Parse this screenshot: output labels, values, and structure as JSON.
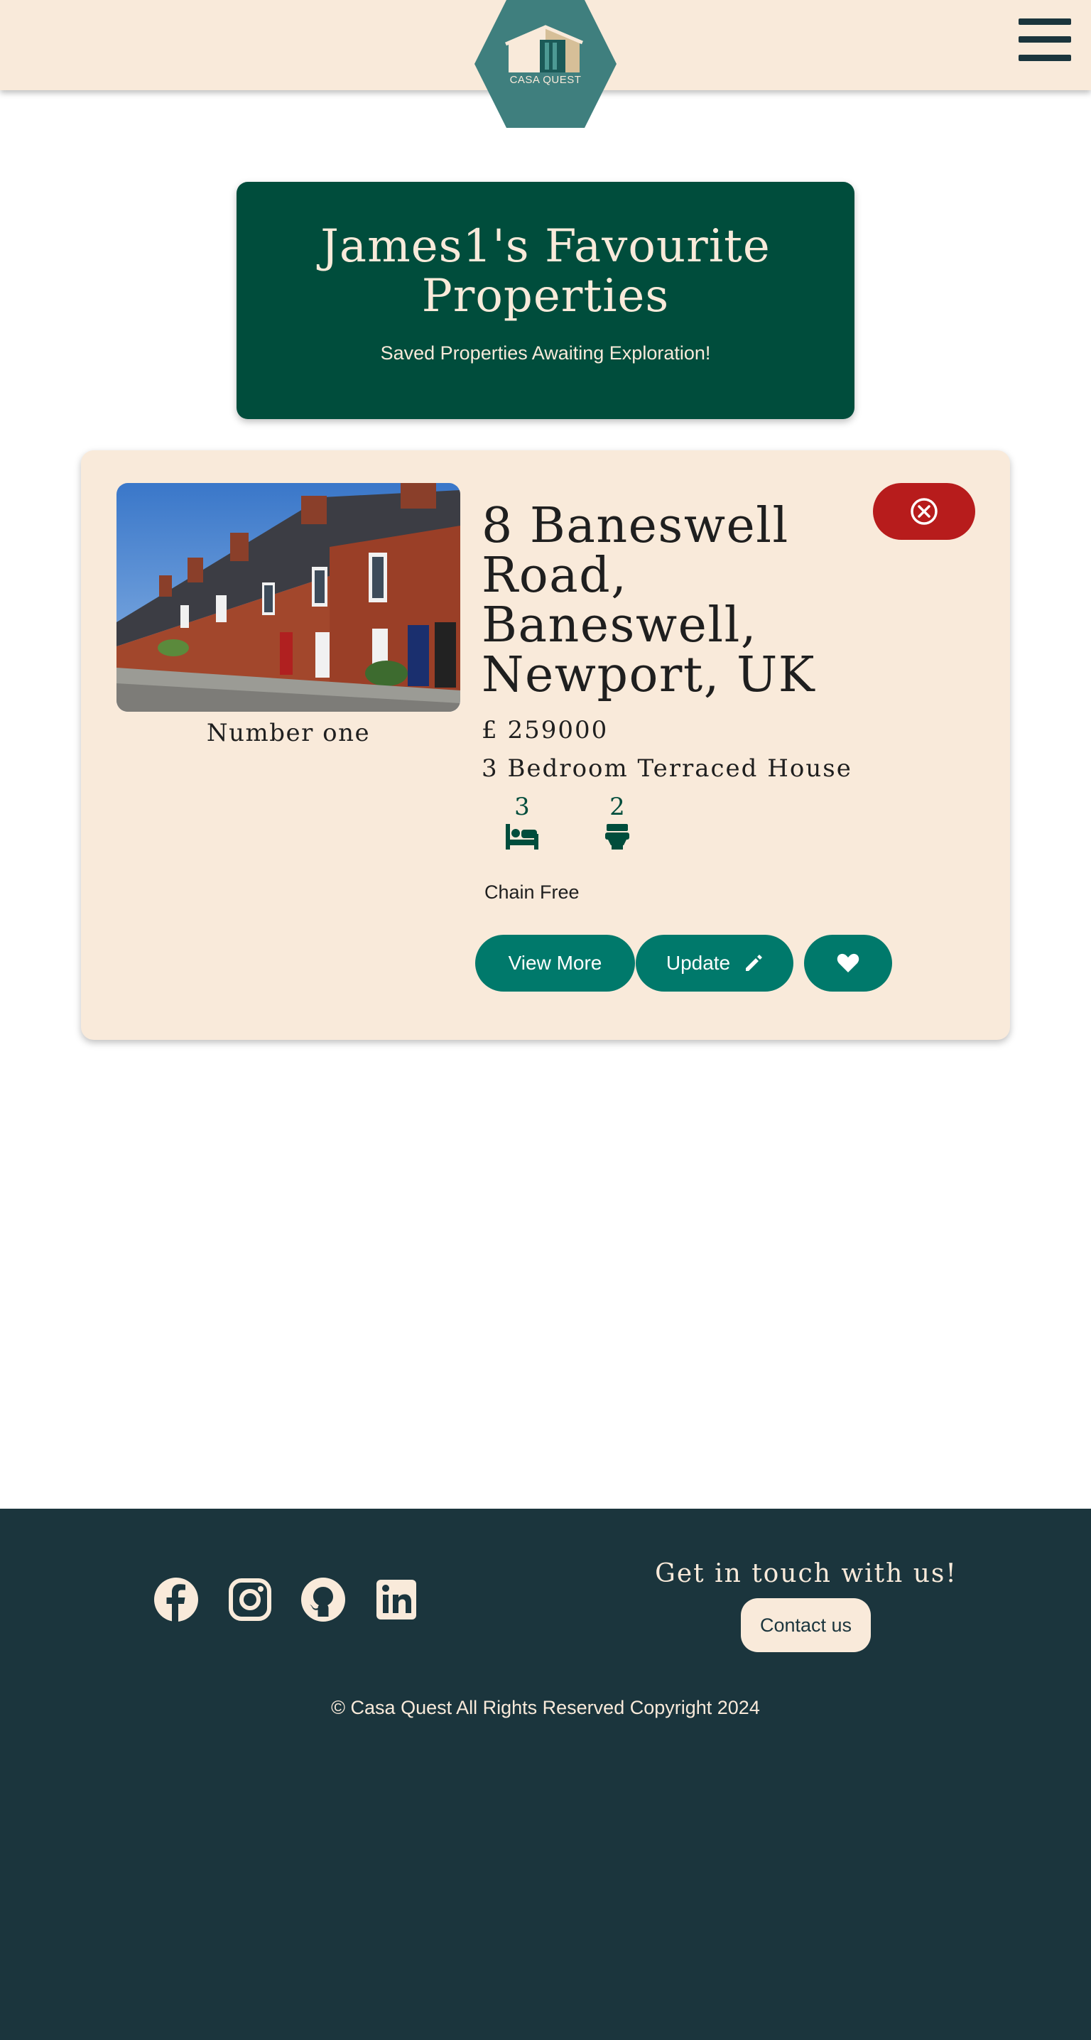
{
  "header": {
    "logo_text": "CASA QUEST",
    "logo_icon": "house-logo-icon",
    "menu_icon": "hamburger-menu-icon"
  },
  "banner": {
    "title": "James1's Favourite Properties",
    "subtitle": "Saved Properties Awaiting Exploration!"
  },
  "property": {
    "image_caption": "Number one",
    "address": "8 Baneswell Road, Baneswell, Newport, UK",
    "price": "£ 259000",
    "type": "3 Bedroom Terraced House",
    "bedrooms": "3",
    "bathrooms": "2",
    "chain_status": "Chain Free",
    "buttons": {
      "view_more": "View More",
      "update": "Update"
    },
    "icons": {
      "remove": "close-circle-icon",
      "bed": "bed-icon",
      "bath": "toilet-icon",
      "edit": "pencil-icon",
      "favourite": "heart-icon"
    }
  },
  "footer": {
    "social": [
      "facebook-icon",
      "instagram-icon",
      "github-icon",
      "linkedin-icon"
    ],
    "get_in_touch": "Get in touch with us!",
    "contact_label": "Contact us",
    "copyright": "© Casa Quest All Rights Reserved Copyright 2024"
  },
  "colors": {
    "cream": "#f9eada",
    "dark_green": "#004d3c",
    "teal": "#00796b",
    "red": "#b71c1c",
    "footer_bg": "#1b353d",
    "logo_bg": "#3f7f7e"
  }
}
